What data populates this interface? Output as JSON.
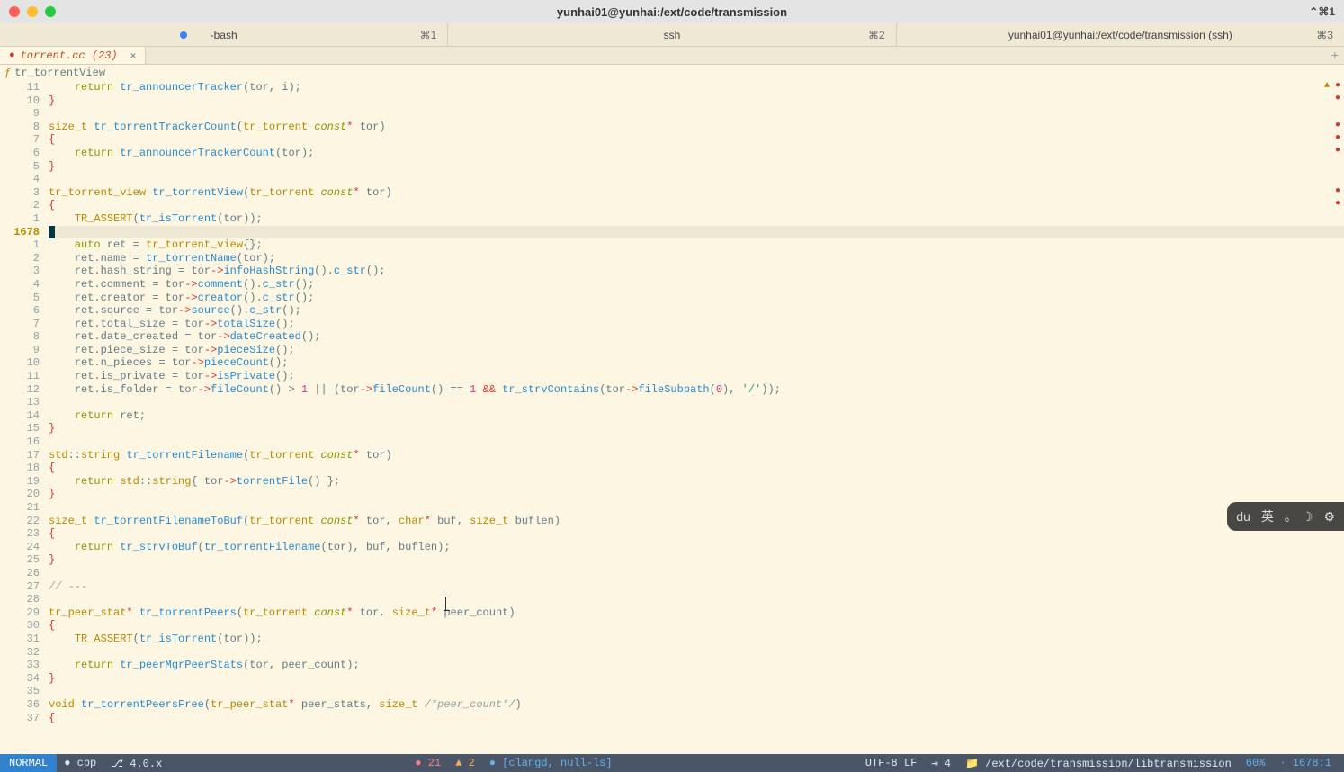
{
  "window": {
    "title": "yunhai01@yunhai:/ext/code/transmission",
    "right_shortcut": "⌃⌘1"
  },
  "terminal_tabs": [
    {
      "label": "-bash",
      "hotkey": "⌘1",
      "has_dot": true
    },
    {
      "label": "ssh",
      "hotkey": "⌘2",
      "has_dot": false
    },
    {
      "label": "yunhai01@yunhai:/ext/code/transmission (ssh)",
      "hotkey": "⌘3",
      "has_dot": false
    }
  ],
  "file_tab": {
    "name": "torrent.cc (23)"
  },
  "breadcrumb": {
    "symbol": "ƒ",
    "name": "tr_torrentView"
  },
  "gutter": [
    "11",
    "10",
    "9",
    "8",
    "7",
    "6",
    "5",
    "4",
    "3",
    "2",
    "1",
    "1678",
    "1",
    "2",
    "3",
    "4",
    "5",
    "6",
    "7",
    "8",
    "9",
    "10",
    "11",
    "12",
    "13",
    "14",
    "15",
    "16",
    "17",
    "18",
    "19",
    "20",
    "21",
    "22",
    "23",
    "24",
    "25",
    "26",
    "27",
    "28",
    "29",
    "30",
    "31",
    "32",
    "33",
    "34",
    "35",
    "36",
    "37"
  ],
  "gutter_current_index": 11,
  "code_tokens": [
    [
      [
        "    ",
        ""
      ],
      [
        "return",
        "kw"
      ],
      [
        " ",
        ""
      ],
      [
        "tr_announcerTracker",
        "fn"
      ],
      [
        "(",
        ""
      ],
      [
        "tor",
        "var"
      ],
      [
        ", ",
        ""
      ],
      [
        "i",
        "var"
      ],
      [
        ");",
        ""
      ]
    ],
    [
      [
        "}",
        "brace"
      ]
    ],
    [
      [
        "",
        ""
      ]
    ],
    [
      [
        "size_t",
        "type"
      ],
      [
        " ",
        ""
      ],
      [
        "tr_torrentTrackerCount",
        "fn"
      ],
      [
        "(",
        ""
      ],
      [
        "tr_torrent",
        "type"
      ],
      [
        " ",
        ""
      ],
      [
        "const",
        "const"
      ],
      [
        "*",
        "op"
      ],
      [
        " ",
        ""
      ],
      [
        "tor",
        "var"
      ],
      [
        ")",
        ""
      ]
    ],
    [
      [
        "{",
        "brace"
      ]
    ],
    [
      [
        "    ",
        ""
      ],
      [
        "return",
        "kw"
      ],
      [
        " ",
        ""
      ],
      [
        "tr_announcerTrackerCount",
        "fn"
      ],
      [
        "(",
        ""
      ],
      [
        "tor",
        "var"
      ],
      [
        ");",
        ""
      ]
    ],
    [
      [
        "}",
        "brace"
      ]
    ],
    [
      [
        "",
        ""
      ]
    ],
    [
      [
        "tr_torrent_view",
        "type"
      ],
      [
        " ",
        ""
      ],
      [
        "tr_torrentView",
        "fn"
      ],
      [
        "(",
        ""
      ],
      [
        "tr_torrent",
        "type"
      ],
      [
        " ",
        ""
      ],
      [
        "const",
        "const"
      ],
      [
        "*",
        "op"
      ],
      [
        " ",
        ""
      ],
      [
        "tor",
        "var"
      ],
      [
        ")",
        ""
      ]
    ],
    [
      [
        "{",
        "brace"
      ]
    ],
    [
      [
        "    ",
        ""
      ],
      [
        "TR_ASSERT",
        "call"
      ],
      [
        "(",
        ""
      ],
      [
        "tr_isTorrent",
        "fn"
      ],
      [
        "(",
        ""
      ],
      [
        "tor",
        "var"
      ],
      [
        "));",
        ""
      ]
    ],
    [
      [
        "",
        ""
      ]
    ],
    [
      [
        "    ",
        ""
      ],
      [
        "auto",
        "kw"
      ],
      [
        " ",
        ""
      ],
      [
        "ret",
        "var"
      ],
      [
        " = ",
        ""
      ],
      [
        "tr_torrent_view",
        "type"
      ],
      [
        "{};",
        ""
      ]
    ],
    [
      [
        "    ret.name = ",
        ""
      ],
      [
        "tr_torrentName",
        "fn"
      ],
      [
        "(",
        ""
      ],
      [
        "tor",
        "var"
      ],
      [
        ");",
        ""
      ]
    ],
    [
      [
        "    ret.hash_string = ",
        ""
      ],
      [
        "tor",
        "var"
      ],
      [
        "->",
        "op"
      ],
      [
        "infoHashString",
        "fn"
      ],
      [
        "().",
        ""
      ],
      [
        "c_str",
        "fn"
      ],
      [
        "();",
        ""
      ]
    ],
    [
      [
        "    ret.comment = ",
        ""
      ],
      [
        "tor",
        "var"
      ],
      [
        "->",
        "op"
      ],
      [
        "comment",
        "fn"
      ],
      [
        "().",
        ""
      ],
      [
        "c_str",
        "fn"
      ],
      [
        "();",
        ""
      ]
    ],
    [
      [
        "    ret.creator = ",
        ""
      ],
      [
        "tor",
        "var"
      ],
      [
        "->",
        "op"
      ],
      [
        "creator",
        "fn"
      ],
      [
        "().",
        ""
      ],
      [
        "c_str",
        "fn"
      ],
      [
        "();",
        ""
      ]
    ],
    [
      [
        "    ret.source = ",
        ""
      ],
      [
        "tor",
        "var"
      ],
      [
        "->",
        "op"
      ],
      [
        "source",
        "fn"
      ],
      [
        "().",
        ""
      ],
      [
        "c_str",
        "fn"
      ],
      [
        "();",
        ""
      ]
    ],
    [
      [
        "    ret.total_size = ",
        ""
      ],
      [
        "tor",
        "var"
      ],
      [
        "->",
        "op"
      ],
      [
        "totalSize",
        "fn"
      ],
      [
        "();",
        ""
      ]
    ],
    [
      [
        "    ret.date_created = ",
        ""
      ],
      [
        "tor",
        "var"
      ],
      [
        "->",
        "op"
      ],
      [
        "dateCreated",
        "fn"
      ],
      [
        "();",
        ""
      ]
    ],
    [
      [
        "    ret.piece_size = ",
        ""
      ],
      [
        "tor",
        "var"
      ],
      [
        "->",
        "op"
      ],
      [
        "pieceSize",
        "fn"
      ],
      [
        "();",
        ""
      ]
    ],
    [
      [
        "    ret.n_pieces = ",
        ""
      ],
      [
        "tor",
        "var"
      ],
      [
        "->",
        "op"
      ],
      [
        "pieceCount",
        "fn"
      ],
      [
        "();",
        ""
      ]
    ],
    [
      [
        "    ret.is_private = ",
        ""
      ],
      [
        "tor",
        "var"
      ],
      [
        "->",
        "op"
      ],
      [
        "isPrivate",
        "fn"
      ],
      [
        "();",
        ""
      ]
    ],
    [
      [
        "    ret.is_folder = ",
        ""
      ],
      [
        "tor",
        "var"
      ],
      [
        "->",
        "op"
      ],
      [
        "fileCount",
        "fn"
      ],
      [
        "() > ",
        ""
      ],
      [
        "1",
        "num"
      ],
      [
        " || (",
        ""
      ],
      [
        "tor",
        "var"
      ],
      [
        "->",
        "op"
      ],
      [
        "fileCount",
        "fn"
      ],
      [
        "() == ",
        ""
      ],
      [
        "1",
        "num"
      ],
      [
        " ",
        ""
      ],
      [
        "&&",
        "op"
      ],
      [
        " ",
        ""
      ],
      [
        "tr_strvContains",
        "fn"
      ],
      [
        "(",
        ""
      ],
      [
        "tor",
        "var"
      ],
      [
        "->",
        "op"
      ],
      [
        "fileSubpath",
        "fn"
      ],
      [
        "(",
        ""
      ],
      [
        "0",
        "num"
      ],
      [
        "), ",
        ""
      ],
      [
        "'/'",
        "str"
      ],
      [
        "));",
        ""
      ]
    ],
    [
      [
        "",
        ""
      ]
    ],
    [
      [
        "    ",
        ""
      ],
      [
        "return",
        "kw"
      ],
      [
        " ret;",
        ""
      ]
    ],
    [
      [
        "}",
        "brace"
      ]
    ],
    [
      [
        "",
        ""
      ]
    ],
    [
      [
        "std",
        "type"
      ],
      [
        "::",
        ""
      ],
      [
        "string",
        "type"
      ],
      [
        " ",
        ""
      ],
      [
        "tr_torrentFilename",
        "fn"
      ],
      [
        "(",
        ""
      ],
      [
        "tr_torrent",
        "type"
      ],
      [
        " ",
        ""
      ],
      [
        "const",
        "const"
      ],
      [
        "*",
        "op"
      ],
      [
        " ",
        ""
      ],
      [
        "tor",
        "var"
      ],
      [
        ")",
        ""
      ]
    ],
    [
      [
        "{",
        "brace"
      ]
    ],
    [
      [
        "    ",
        ""
      ],
      [
        "return",
        "kw"
      ],
      [
        " ",
        ""
      ],
      [
        "std",
        "type"
      ],
      [
        "::",
        ""
      ],
      [
        "string",
        "type"
      ],
      [
        "{ ",
        ""
      ],
      [
        "tor",
        "var"
      ],
      [
        "->",
        "op"
      ],
      [
        "torrentFile",
        "fn"
      ],
      [
        "() };",
        ""
      ]
    ],
    [
      [
        "}",
        "brace"
      ]
    ],
    [
      [
        "",
        ""
      ]
    ],
    [
      [
        "size_t",
        "type"
      ],
      [
        " ",
        ""
      ],
      [
        "tr_torrentFilenameToBuf",
        "fn"
      ],
      [
        "(",
        ""
      ],
      [
        "tr_torrent",
        "type"
      ],
      [
        " ",
        ""
      ],
      [
        "const",
        "const"
      ],
      [
        "*",
        "op"
      ],
      [
        " ",
        ""
      ],
      [
        "tor",
        "var"
      ],
      [
        ", ",
        ""
      ],
      [
        "char",
        "type"
      ],
      [
        "*",
        "op"
      ],
      [
        " ",
        ""
      ],
      [
        "buf",
        "var"
      ],
      [
        ", ",
        ""
      ],
      [
        "size_t",
        "type"
      ],
      [
        " ",
        ""
      ],
      [
        "buflen",
        "var"
      ],
      [
        ")",
        ""
      ]
    ],
    [
      [
        "{",
        "brace"
      ]
    ],
    [
      [
        "    ",
        ""
      ],
      [
        "return",
        "kw"
      ],
      [
        " ",
        ""
      ],
      [
        "tr_strvToBuf",
        "fn"
      ],
      [
        "(",
        ""
      ],
      [
        "tr_torrentFilename",
        "fn"
      ],
      [
        "(",
        ""
      ],
      [
        "tor",
        "var"
      ],
      [
        "), ",
        ""
      ],
      [
        "buf",
        "var"
      ],
      [
        ", ",
        ""
      ],
      [
        "buflen",
        "var"
      ],
      [
        ");",
        ""
      ]
    ],
    [
      [
        "}",
        "brace"
      ]
    ],
    [
      [
        "",
        ""
      ]
    ],
    [
      [
        "// ---",
        "comment"
      ]
    ],
    [
      [
        "",
        ""
      ]
    ],
    [
      [
        "tr_peer_stat",
        "type"
      ],
      [
        "*",
        "op"
      ],
      [
        " ",
        ""
      ],
      [
        "tr_torrentPeers",
        "fn"
      ],
      [
        "(",
        ""
      ],
      [
        "tr_torrent",
        "type"
      ],
      [
        " ",
        ""
      ],
      [
        "const",
        "const"
      ],
      [
        "*",
        "op"
      ],
      [
        " ",
        ""
      ],
      [
        "tor",
        "var"
      ],
      [
        ", ",
        ""
      ],
      [
        "size_t",
        "type"
      ],
      [
        "*",
        "op"
      ],
      [
        " ",
        ""
      ],
      [
        "peer_count",
        "var"
      ],
      [
        ")",
        ""
      ]
    ],
    [
      [
        "{",
        "brace"
      ]
    ],
    [
      [
        "    ",
        ""
      ],
      [
        "TR_ASSERT",
        "call"
      ],
      [
        "(",
        ""
      ],
      [
        "tr_isTorrent",
        "fn"
      ],
      [
        "(",
        ""
      ],
      [
        "tor",
        "var"
      ],
      [
        "));",
        ""
      ]
    ],
    [
      [
        "",
        ""
      ]
    ],
    [
      [
        "    ",
        ""
      ],
      [
        "return",
        "kw"
      ],
      [
        " ",
        ""
      ],
      [
        "tr_peerMgrPeerStats",
        "fn"
      ],
      [
        "(",
        ""
      ],
      [
        "tor",
        "var"
      ],
      [
        ", ",
        ""
      ],
      [
        "peer_count",
        "var"
      ],
      [
        ");",
        ""
      ]
    ],
    [
      [
        "}",
        "brace"
      ]
    ],
    [
      [
        "",
        ""
      ]
    ],
    [
      [
        "void",
        "type"
      ],
      [
        " ",
        ""
      ],
      [
        "tr_torrentPeersFree",
        "fn"
      ],
      [
        "(",
        ""
      ],
      [
        "tr_peer_stat",
        "type"
      ],
      [
        "*",
        "op"
      ],
      [
        " ",
        ""
      ],
      [
        "peer_stats",
        "var"
      ],
      [
        ", ",
        ""
      ],
      [
        "size_t",
        "type"
      ],
      [
        " ",
        ""
      ],
      [
        "/*peer_count*/",
        "comment"
      ],
      [
        ")",
        ""
      ]
    ],
    [
      [
        "{",
        "brace"
      ]
    ]
  ],
  "status": {
    "mode": "NORMAL",
    "filetype": "cpp",
    "branch": "4.0.x",
    "errors": "21",
    "warnings": "2",
    "lsp": "[clangd, null-ls]",
    "encoding": "UTF-8 LF",
    "indent": "⇥ 4",
    "path": "/ext/code/transmission/libtransmission",
    "percent": "60%",
    "position": "1678:1"
  },
  "floating": {
    "items": [
      "du",
      "英",
      "｡",
      "☽",
      "⚙"
    ]
  }
}
